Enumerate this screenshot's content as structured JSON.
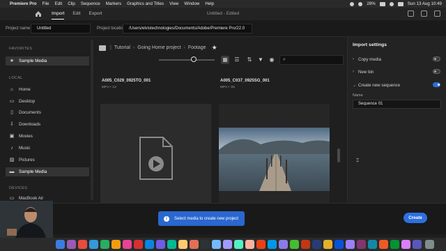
{
  "menubar": {
    "app_name": "Premiere Pro",
    "items": [
      "File",
      "Edit",
      "Clip",
      "Sequence",
      "Markers",
      "Graphics and Titles",
      "View",
      "Window",
      "Help"
    ],
    "battery": "28%",
    "datetime": "Sun 13 Aug  10:49"
  },
  "header": {
    "tabs": [
      {
        "label": "Import",
        "active": true
      },
      {
        "label": "Edit",
        "active": false
      },
      {
        "label": "Export",
        "active": false
      }
    ],
    "doc_title": "Untitled - Edited"
  },
  "project": {
    "name_label": "Project name",
    "name_value": "Untitled",
    "location_label": "Project location",
    "location_value": "/Users/elvistechnologies/Documents/Adobe/Premiere Pro/22.0"
  },
  "sidebar": {
    "favorites_label": "FAVORITES",
    "favorites": [
      {
        "label": "Sample Media",
        "icon": "star-icon"
      }
    ],
    "local_label": "LOCAL",
    "local": [
      {
        "label": "Home",
        "icon": "home-icon"
      },
      {
        "label": "Desktop",
        "icon": "desktop-icon"
      },
      {
        "label": "Documents",
        "icon": "document-icon"
      },
      {
        "label": "Downloads",
        "icon": "download-icon"
      },
      {
        "label": "Movies",
        "icon": "film-icon"
      },
      {
        "label": "Music",
        "icon": "music-icon"
      },
      {
        "label": "Pictures",
        "icon": "picture-icon"
      },
      {
        "label": "Sample Media",
        "icon": "folder-icon"
      }
    ],
    "devices_label": "DEVICES",
    "devices": [
      {
        "label": "MacBook Air",
        "icon": "laptop-icon"
      }
    ]
  },
  "browser": {
    "breadcrumb": [
      "Tutorial",
      "Going Home project",
      "Footage"
    ],
    "clips": [
      {
        "name": "A005_C029_0925TO_001",
        "meta": "MP4 • :12"
      },
      {
        "name": "A005_C037_0925SG_001",
        "meta": "MP4 • :05"
      }
    ],
    "search_placeholder": ""
  },
  "import_settings": {
    "title": "Import settings",
    "copy_media": {
      "label": "Copy media",
      "on": false
    },
    "new_bin": {
      "label": "New bin",
      "on": false
    },
    "create_sequence": {
      "label": "Create new sequence",
      "on": true
    },
    "name_label": "Name",
    "name_value": "Sequence 01"
  },
  "footer": {
    "toast": "Select media to create new project",
    "create_label": "Create"
  },
  "colors": {
    "accent": "#2d6fe0",
    "panel": "#232323",
    "background": "#1e1e1e"
  }
}
